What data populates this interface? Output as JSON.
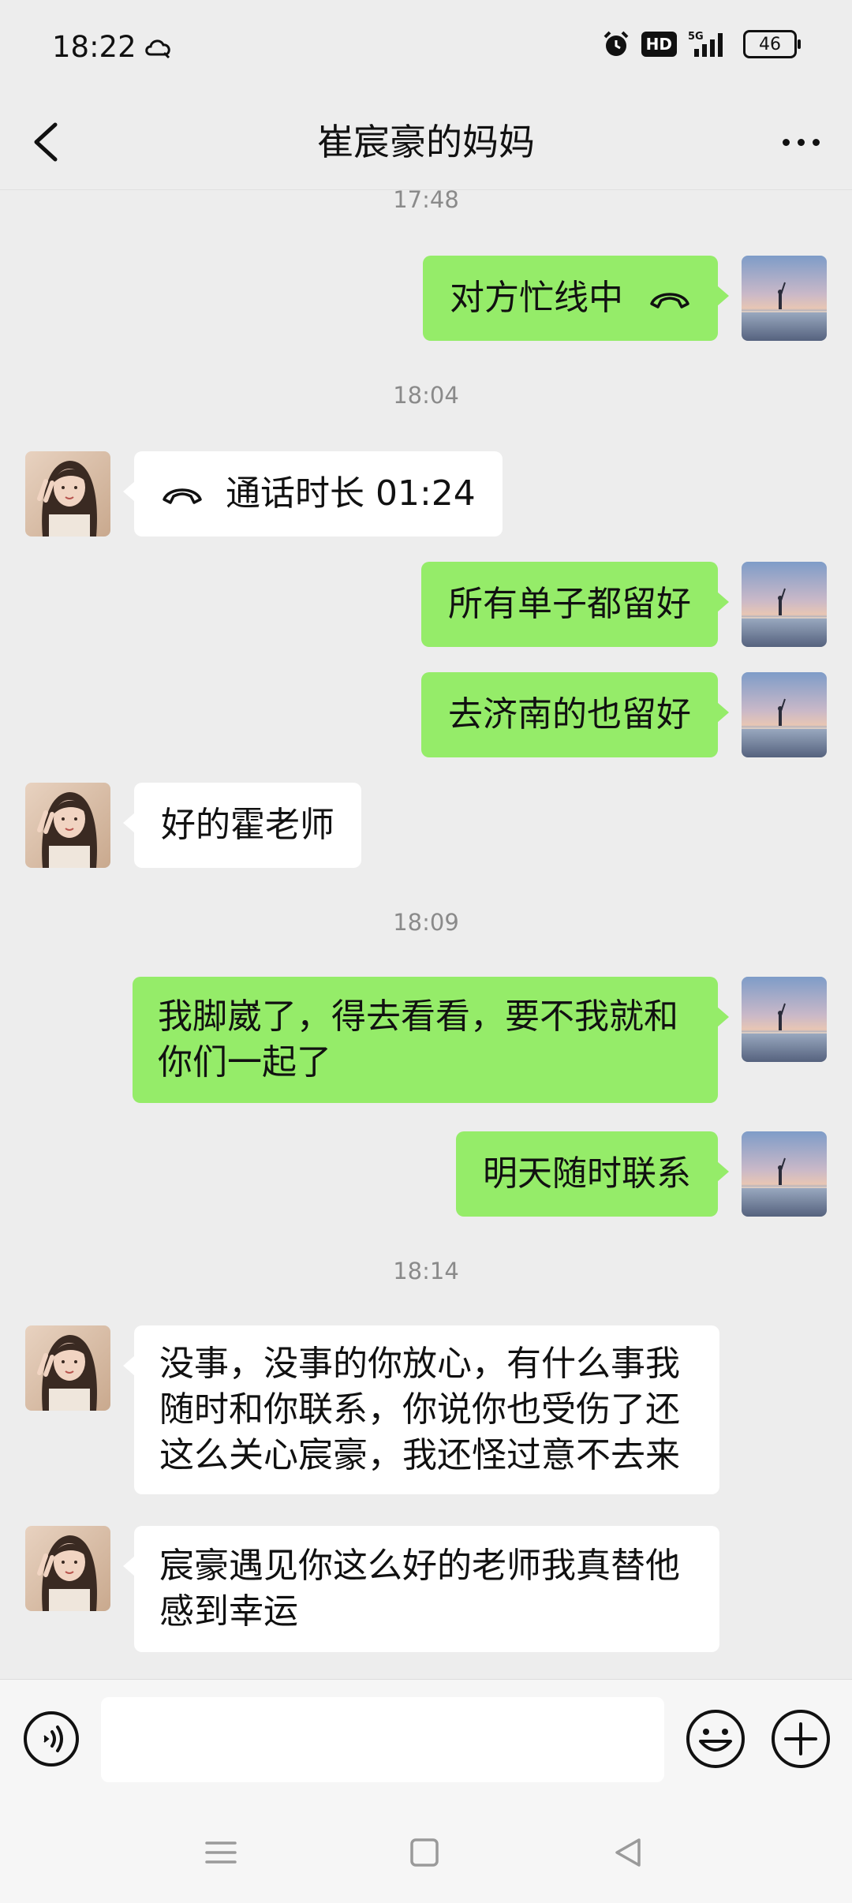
{
  "status_bar": {
    "time": "18:22",
    "battery": "46",
    "icons": [
      "cloud-icon",
      "alarm-icon",
      "hd-icon",
      "5g-signal-icon",
      "battery-icon"
    ]
  },
  "header": {
    "title": "崔宸豪的妈妈",
    "icons": [
      "back-icon",
      "more-icon"
    ]
  },
  "conversation": {
    "timestamps": [
      "17:48",
      "18:04",
      "18:09",
      "18:14"
    ],
    "messages": [
      {
        "side": "right",
        "text": "对方忙线中",
        "type": "call"
      },
      {
        "side": "left",
        "text": "通话时长 01:24",
        "type": "call"
      },
      {
        "side": "right",
        "text": "所有单子都留好"
      },
      {
        "side": "right",
        "text": "去济南的也留好"
      },
      {
        "side": "left",
        "text": "好的霍老师"
      },
      {
        "side": "right",
        "lines": [
          "我脚崴了，得去看看，要不我就和",
          "你们一起了"
        ]
      },
      {
        "side": "right",
        "text": "明天随时联系"
      },
      {
        "side": "left",
        "lines": [
          "没事，没事的你放心，有什么事我",
          "随时和你联系，你说你也受伤了还",
          "这么关心宸豪，我还怪过意不去来"
        ]
      },
      {
        "side": "left",
        "lines": [
          "宸豪遇见你这么好的老师我真替他",
          "感到幸运"
        ]
      }
    ]
  },
  "input_bar": {
    "value": "",
    "icons": [
      "voice-icon",
      "emoji-icon",
      "plus-icon"
    ]
  },
  "system_nav": {
    "icons": [
      "menu-icon",
      "home-icon",
      "back-triangle-icon"
    ]
  },
  "colors": {
    "background": "#ededed",
    "bubble_sent": "#95ec69",
    "bubble_received": "#ffffff"
  }
}
